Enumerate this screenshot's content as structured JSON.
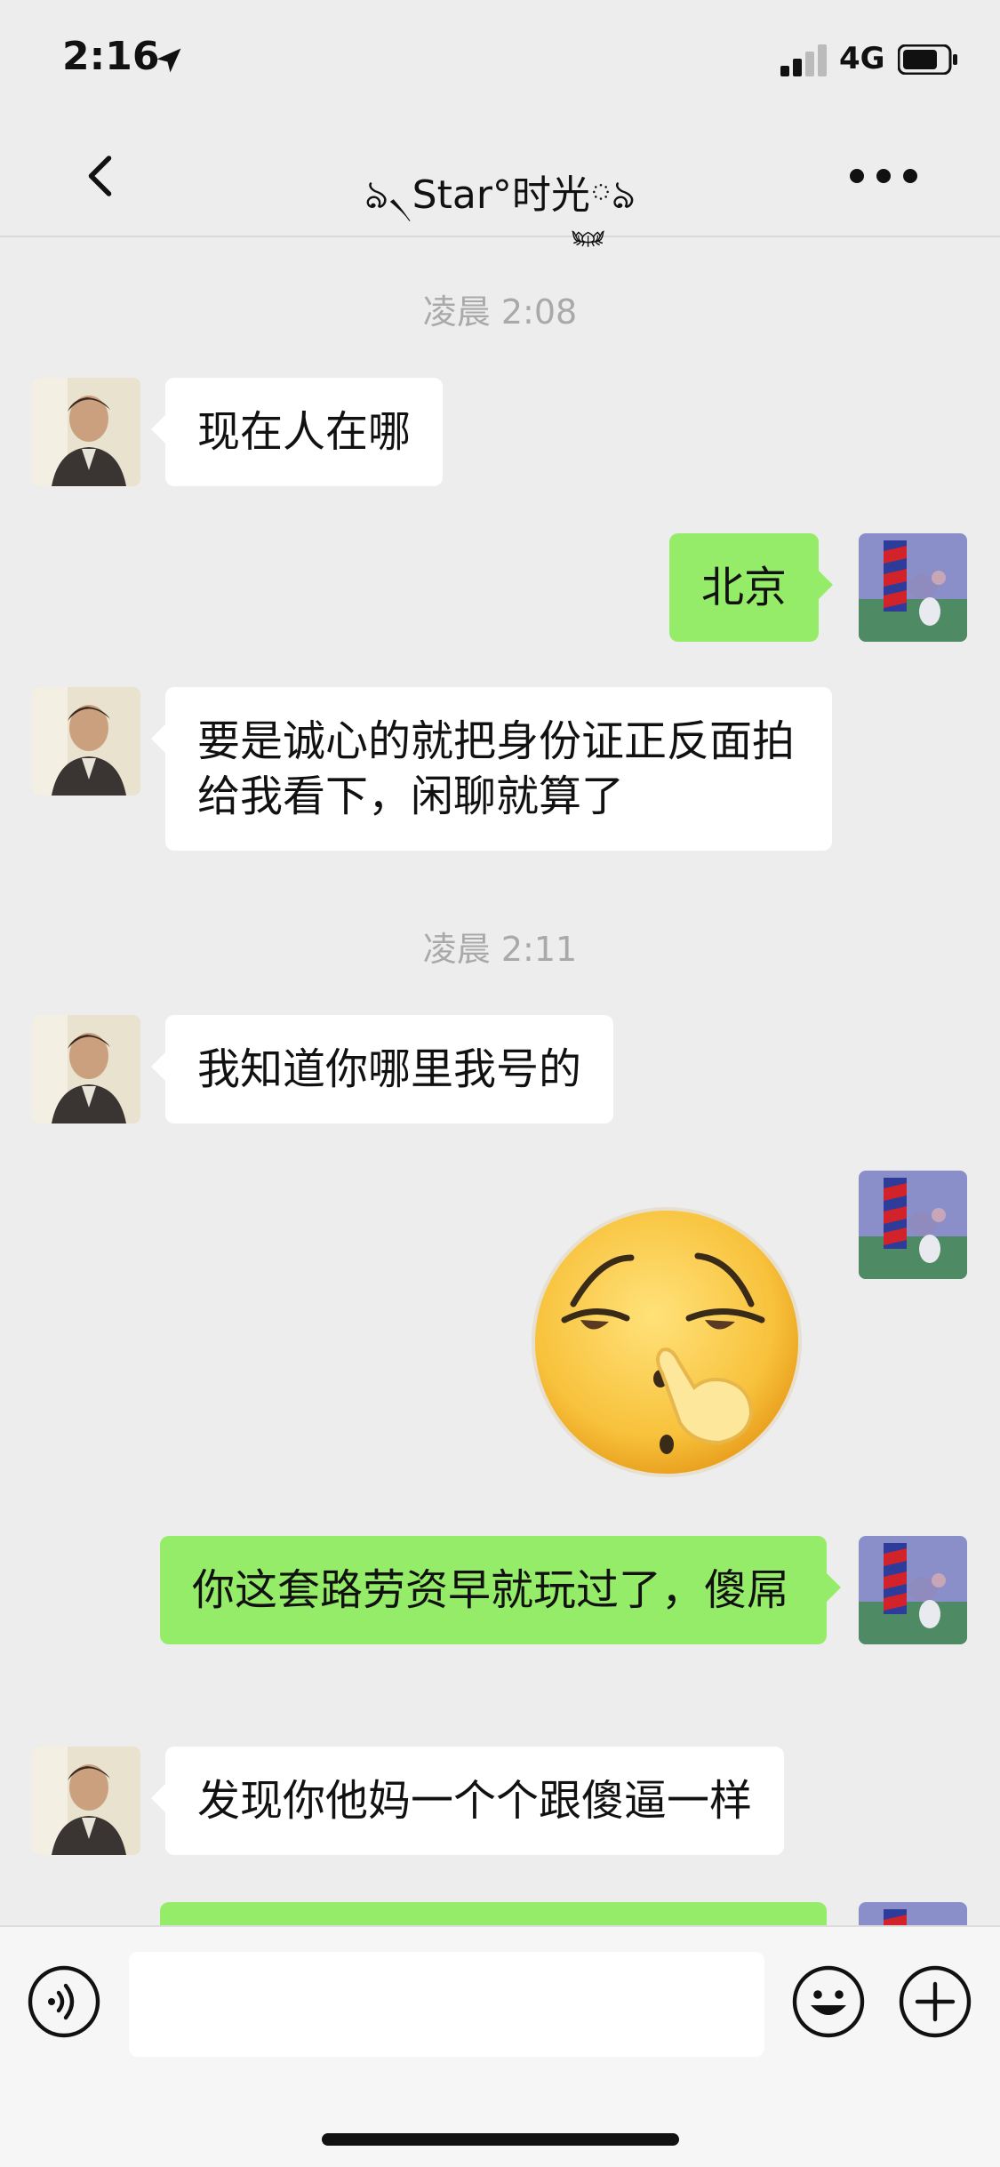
{
  "status_bar": {
    "time": "2:16",
    "network": "4G"
  },
  "header": {
    "title": "ঌ৲Star°时光࿆ঌ"
  },
  "messages": [
    {
      "type": "time",
      "text": "凌晨 2:08"
    },
    {
      "type": "msg",
      "side": "left",
      "text": "现在人在哪"
    },
    {
      "type": "msg",
      "side": "right",
      "text": "北京"
    },
    {
      "type": "msg",
      "side": "left",
      "text": "要是诚心的就把身份证正反面拍给我看下，闲聊就算了"
    },
    {
      "type": "time",
      "text": "凌晨 2:11"
    },
    {
      "type": "msg",
      "side": "left",
      "text": "我知道你哪里我号的"
    },
    {
      "type": "sticker",
      "side": "right",
      "name": "nose-picking-emoji"
    },
    {
      "type": "msg",
      "side": "right",
      "text": "你这套路劳资早就玩过了，傻屌"
    },
    {
      "type": "msg",
      "side": "left",
      "text": "发现你他妈一个个跟傻逼一样"
    },
    {
      "type": "msg",
      "side": "right",
      "text": ""
    }
  ],
  "input": {
    "value": "",
    "placeholder": ""
  },
  "colors": {
    "background": "#ededed",
    "self_bubble": "#95ec69",
    "other_bubble": "#ffffff",
    "time_label": "#a9a9a9"
  },
  "icons": [
    "back-icon",
    "more-icon",
    "voice-icon",
    "emoji-icon",
    "plus-icon",
    "location-arrow-icon",
    "signal-icon",
    "battery-icon"
  ]
}
